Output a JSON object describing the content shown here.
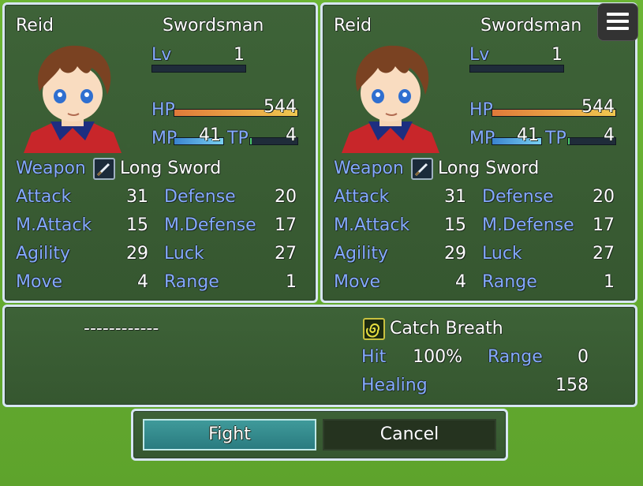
{
  "left": {
    "name": "Reid",
    "class": "Swordsman",
    "lv_label": "Lv",
    "lv": "1",
    "hp_label": "HP",
    "hp": "544",
    "mp_label": "MP",
    "mp": "41",
    "tp_label": "TP",
    "tp": "4",
    "weapon_label": "Weapon",
    "weapon": "Long Sword",
    "stats": {
      "attack_label": "Attack",
      "attack": "31",
      "defense_label": "Defense",
      "defense": "20",
      "matk_label": "M.Attack",
      "matk": "15",
      "mdef_label": "M.Defense",
      "mdef": "17",
      "agi_label": "Agility",
      "agi": "29",
      "luck_label": "Luck",
      "luck": "27",
      "move_label": "Move",
      "move": "4",
      "range_label": "Range",
      "range": "1"
    }
  },
  "right": {
    "name": "Reid",
    "class": "Swordsman",
    "lv_label": "Lv",
    "lv": "1",
    "hp_label": "HP",
    "hp": "544",
    "mp_label": "MP",
    "mp": "41",
    "tp_label": "TP",
    "tp": "4",
    "weapon_label": "Weapon",
    "weapon": "Long Sword",
    "stats": {
      "attack_label": "Attack",
      "attack": "31",
      "defense_label": "Defense",
      "defense": "20",
      "matk_label": "M.Attack",
      "matk": "15",
      "mdef_label": "M.Defense",
      "mdef": "17",
      "agi_label": "Agility",
      "agi": "29",
      "luck_label": "Luck",
      "luck": "27",
      "move_label": "Move",
      "move": "4",
      "range_label": "Range",
      "range": "1"
    }
  },
  "skill": {
    "left_text": "------------",
    "name": "Catch Breath",
    "hit_label": "Hit",
    "hit": "100%",
    "range_label": "Range",
    "range": "0",
    "healing_label": "Healing",
    "healing": "158"
  },
  "commands": {
    "fight": "Fight",
    "cancel": "Cancel"
  },
  "colors": {
    "system": "#84aaff",
    "hp": "#e8a44a",
    "mp": "#5ab4e8",
    "tp": "#4ac86a",
    "window_border": "#d7e6f3"
  },
  "icons": {
    "menu": "hamburger-menu-icon",
    "weapon": "sword-icon",
    "skill": "swirl-icon"
  }
}
